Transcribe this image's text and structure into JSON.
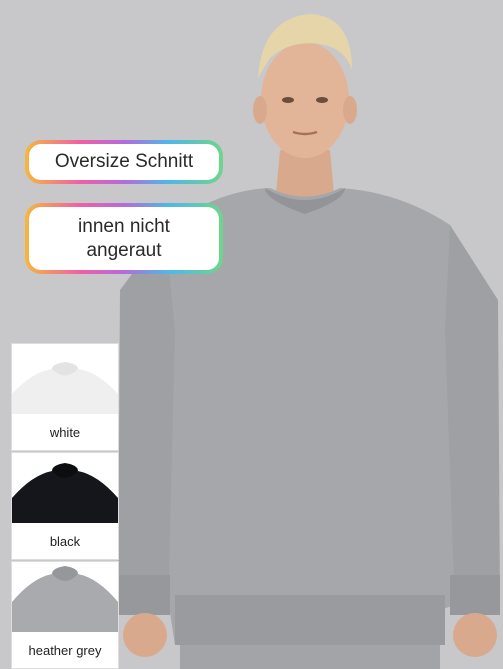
{
  "badges": {
    "fit": "Oversize Schnitt",
    "inside": "innen nicht\nangeraut"
  },
  "colors": [
    {
      "label": "white",
      "hex": "#f2f2f2"
    },
    {
      "label": "black",
      "hex": "#15161b"
    },
    {
      "label": "heather grey",
      "hex": "#a9aaad"
    }
  ],
  "accent": {
    "gradient": [
      "#f6b73c",
      "#f05fa6",
      "#b36bdb",
      "#4fb7e8",
      "#6fd58a"
    ]
  }
}
